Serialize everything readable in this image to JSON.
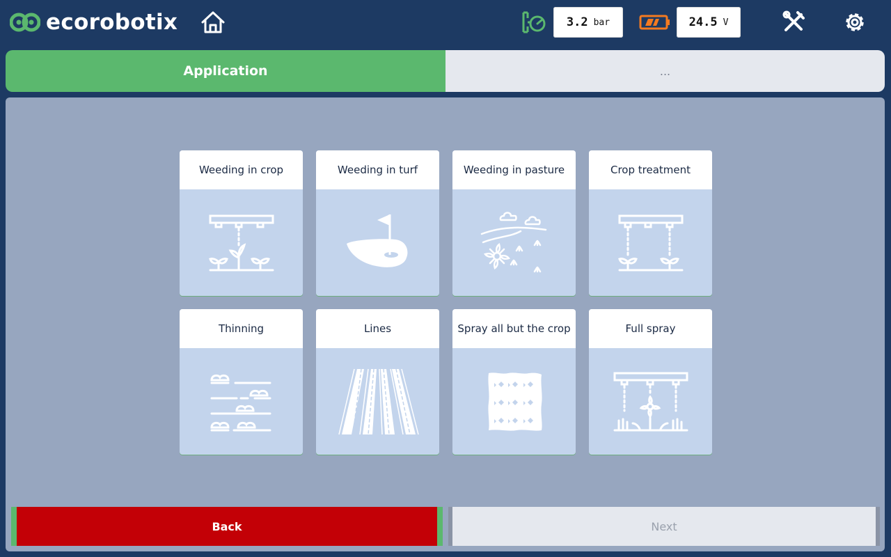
{
  "header": {
    "brand": "ecorobotix",
    "pressure": {
      "value": "3.2",
      "unit": "bar"
    },
    "voltage": {
      "value": "24.5",
      "unit": "V"
    },
    "icons": [
      "home-icon",
      "pressure-gauge-icon",
      "battery-icon",
      "tools-icon",
      "gear-icon"
    ]
  },
  "steps": {
    "current": "Application",
    "next": "..."
  },
  "applications": [
    {
      "label": "Weeding in crop",
      "icon": "weeding-in-crop-icon"
    },
    {
      "label": "Weeding in turf",
      "icon": "weeding-in-turf-icon"
    },
    {
      "label": "Weeding in pasture",
      "icon": "weeding-in-pasture-icon"
    },
    {
      "label": "Crop treatment",
      "icon": "crop-treatment-icon"
    },
    {
      "label": "Thinning",
      "icon": "thinning-icon"
    },
    {
      "label": "Lines",
      "icon": "lines-icon"
    },
    {
      "label": "Spray all but the crop",
      "icon": "spray-all-but-crop-icon"
    },
    {
      "label": "Full spray",
      "icon": "full-spray-icon"
    }
  ],
  "footer": {
    "back_label": "Back",
    "next_label": "Next"
  },
  "colors": {
    "header_bg": "#1d3a63",
    "accent_green": "#5bb86e",
    "panel_bg": "#97a6bf",
    "card_art_bg": "#c3d4ec",
    "back_red": "#c30006",
    "battery_orange": "#f47a20"
  }
}
